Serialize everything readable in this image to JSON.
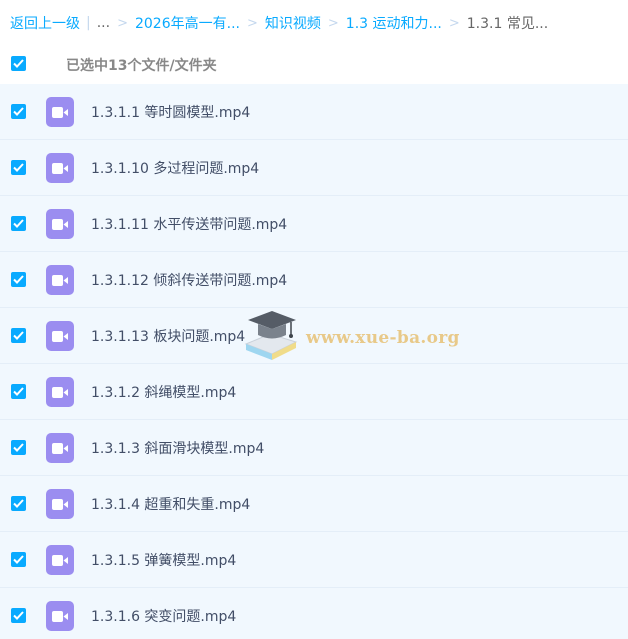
{
  "breadcrumb": {
    "back_label": "返回上一级",
    "separator": "|",
    "ellipsis": "...",
    "arrow": ">",
    "crumbs": [
      "2026年高一有...",
      "知识视频",
      "1.3 运动和力..."
    ],
    "current": "1.3.1 常见..."
  },
  "header": {
    "selection_label": "已选中13个文件/文件夹"
  },
  "colors": {
    "accent": "#09aaff",
    "row_background": "#f1f8fe",
    "file_icon": "#9b8df0",
    "watermark": "#e8c989"
  },
  "files": [
    {
      "name": "1.3.1.1 等时圆模型.mp4",
      "icon": "video-file-icon",
      "selected": true
    },
    {
      "name": "1.3.1.10 多过程问题.mp4",
      "icon": "video-file-icon",
      "selected": true
    },
    {
      "name": "1.3.1.11 水平传送带问题.mp4",
      "icon": "video-file-icon",
      "selected": true
    },
    {
      "name": "1.3.1.12 倾斜传送带问题.mp4",
      "icon": "video-file-icon",
      "selected": true
    },
    {
      "name": "1.3.1.13 板块问题.mp4",
      "icon": "video-file-icon",
      "selected": true
    },
    {
      "name": "1.3.1.2 斜绳模型.mp4",
      "icon": "video-file-icon",
      "selected": true
    },
    {
      "name": "1.3.1.3 斜面滑块模型.mp4",
      "icon": "video-file-icon",
      "selected": true
    },
    {
      "name": "1.3.1.4 超重和失重.mp4",
      "icon": "video-file-icon",
      "selected": true
    },
    {
      "name": "1.3.1.5 弹簧模型.mp4",
      "icon": "video-file-icon",
      "selected": true
    },
    {
      "name": "1.3.1.6 突变问题.mp4",
      "icon": "video-file-icon",
      "selected": true
    }
  ],
  "watermark": {
    "text": "www.xue-ba.org",
    "icon": "graduation-cap-icon"
  }
}
